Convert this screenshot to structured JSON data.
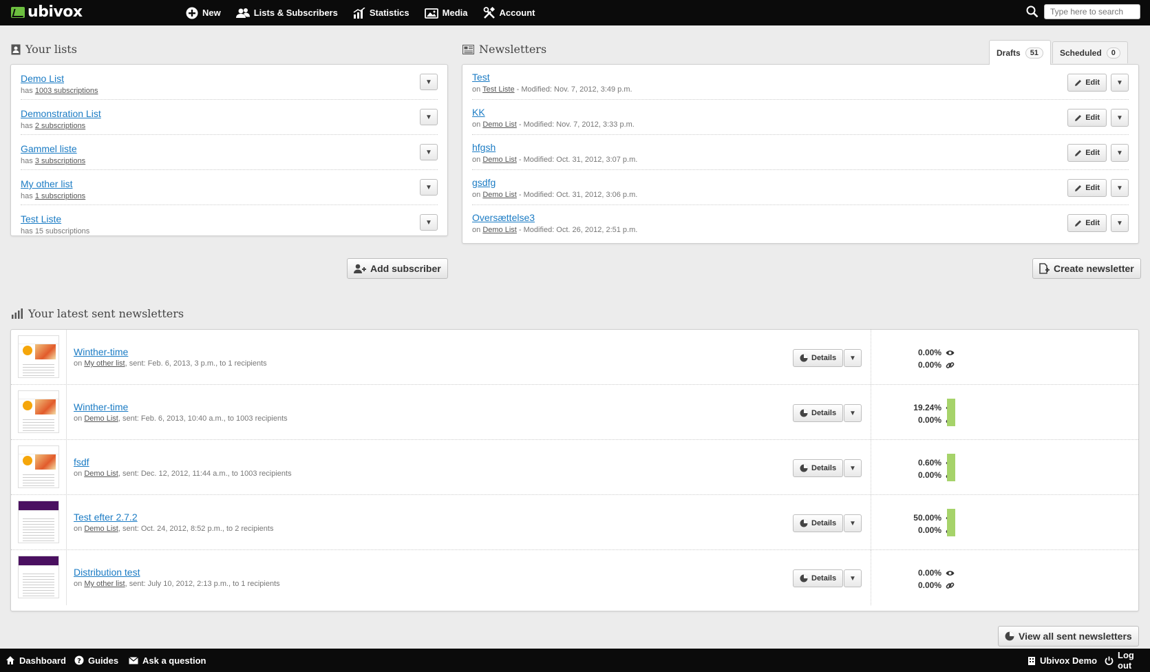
{
  "brand": {
    "name": "ubivox",
    "logo_color": "#6cbf3f"
  },
  "topnav": [
    {
      "label": "New",
      "icon": "plus-circle-icon"
    },
    {
      "label": "Lists & Subscribers",
      "icon": "users-icon"
    },
    {
      "label": "Statistics",
      "icon": "bar-chart-icon"
    },
    {
      "label": "Media",
      "icon": "image-icon"
    },
    {
      "label": "Account",
      "icon": "tools-icon"
    }
  ],
  "search": {
    "placeholder": "Type here to search"
  },
  "lists": {
    "heading": "Your lists",
    "items": [
      {
        "name": "Demo List",
        "prefix": "has",
        "count": "1003 subscriptions"
      },
      {
        "name": "Demonstration List",
        "prefix": "has",
        "count": "2 subscriptions"
      },
      {
        "name": "Gammel liste",
        "prefix": "has",
        "count": "3 subscriptions"
      },
      {
        "name": "My other list",
        "prefix": "has",
        "count": "1 subscriptions"
      },
      {
        "name": "Test Liste",
        "prefix": "has",
        "count": "15 subscriptions"
      }
    ],
    "add_button": "Add subscriber"
  },
  "newsletters": {
    "heading": "Newsletters",
    "tabs": [
      {
        "label": "Drafts",
        "count": "51"
      },
      {
        "label": "Scheduled",
        "count": "0"
      }
    ],
    "items": [
      {
        "name": "Test",
        "list": "Test Liste",
        "modified": " - Modified: Nov. 7, 2012, 3:49 p.m."
      },
      {
        "name": "KK",
        "list": "Demo List",
        "modified": " - Modified: Nov. 7, 2012, 3:33 p.m."
      },
      {
        "name": "hfgsh",
        "list": "Demo List",
        "modified": " - Modified: Oct. 31, 2012, 3:07 p.m."
      },
      {
        "name": "gsdfg",
        "list": "Demo List",
        "modified": " - Modified: Oct. 31, 2012, 3:06 p.m."
      },
      {
        "name": "Oversættelse3",
        "list": "Demo List",
        "modified": " - Modified: Oct. 26, 2012, 2:51 p.m."
      }
    ],
    "on_label": "on",
    "edit_label": "Edit",
    "create_button": "Create newsletter"
  },
  "sent": {
    "heading": "Your latest sent newsletters",
    "on_label": "on",
    "details_label": "Details",
    "items": [
      {
        "name": "Winther-time",
        "list": "My other list",
        "info": ", sent: Feb. 6, 2013, 3 p.m., to 1 recipients",
        "open": "0.00%",
        "click": "0.00%",
        "open_rate": 0.0,
        "thumb": "orange"
      },
      {
        "name": "Winther-time",
        "list": "Demo List",
        "info": ", sent: Feb. 6, 2013, 10:40 a.m., to 1003 recipients",
        "open": "19.24%",
        "click": "0.00%",
        "open_rate": 19.24,
        "thumb": "orange"
      },
      {
        "name": "fsdf",
        "list": "Demo List",
        "info": ", sent: Dec. 12, 2012, 11:44 a.m., to 1003 recipients",
        "open": "0.60%",
        "click": "0.00%",
        "open_rate": 0.6,
        "thumb": "orange"
      },
      {
        "name": "Test efter 2.7.2",
        "list": "Demo List",
        "info": ", sent: Oct. 24, 2012, 8:52 p.m., to 2 recipients",
        "open": "50.00%",
        "click": "0.00%",
        "open_rate": 50.0,
        "thumb": "purple"
      },
      {
        "name": "Distribution test",
        "list": "My other list",
        "info": ", sent: July 10, 2012, 2:13 p.m., to 1 recipients",
        "open": "0.00%",
        "click": "0.00%",
        "open_rate": 0.0,
        "thumb": "purple"
      }
    ],
    "view_all_button": "View all sent newsletters",
    "bar_color": "#a6d36a"
  },
  "footer": {
    "left": [
      {
        "label": "Dashboard",
        "icon": "home-icon"
      },
      {
        "label": "Guides",
        "icon": "question-icon"
      },
      {
        "label": "Ask a question",
        "icon": "envelope-icon"
      }
    ],
    "right": [
      {
        "label": "Ubivox Demo",
        "icon": "building-icon"
      },
      {
        "label": "Log out",
        "icon": "power-icon"
      }
    ]
  }
}
